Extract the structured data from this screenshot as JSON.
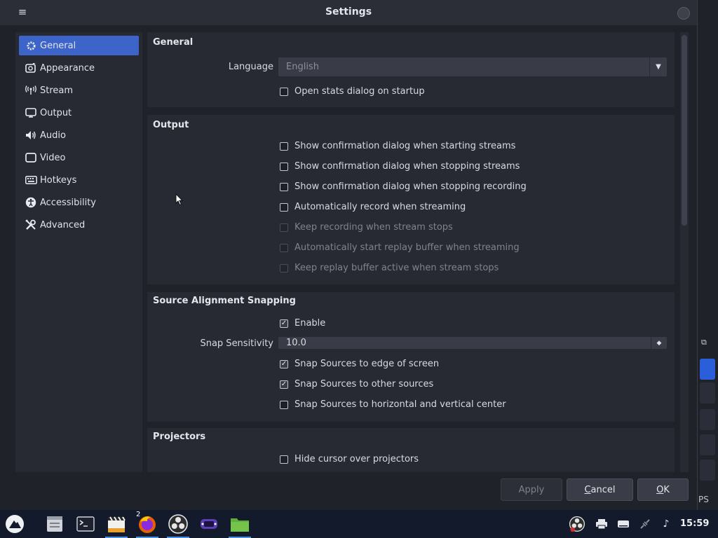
{
  "window": {
    "title": "Settings"
  },
  "sidebar": {
    "items": [
      {
        "label": "General",
        "icon": "gear-icon",
        "active": true
      },
      {
        "label": "Appearance",
        "icon": "appearance-icon"
      },
      {
        "label": "Stream",
        "icon": "broadcast-icon"
      },
      {
        "label": "Output",
        "icon": "output-icon"
      },
      {
        "label": "Audio",
        "icon": "speaker-icon"
      },
      {
        "label": "Video",
        "icon": "monitor-icon"
      },
      {
        "label": "Hotkeys",
        "icon": "keyboard-icon"
      },
      {
        "label": "Accessibility",
        "icon": "accessibility-icon"
      },
      {
        "label": "Advanced",
        "icon": "tools-icon"
      }
    ]
  },
  "general": {
    "title": "General",
    "language_label": "Language",
    "language_value": "English",
    "open_stats": "Open stats dialog on startup"
  },
  "output": {
    "title": "Output",
    "items": [
      {
        "label": "Show confirmation dialog when starting streams",
        "checked": false,
        "disabled": false
      },
      {
        "label": "Show confirmation dialog when stopping streams",
        "checked": false,
        "disabled": false
      },
      {
        "label": "Show confirmation dialog when stopping recording",
        "checked": false,
        "disabled": false
      },
      {
        "label": "Automatically record when streaming",
        "checked": false,
        "disabled": false
      },
      {
        "label": "Keep recording when stream stops",
        "checked": false,
        "disabled": true
      },
      {
        "label": "Automatically start replay buffer when streaming",
        "checked": false,
        "disabled": true
      },
      {
        "label": "Keep replay buffer active when stream stops",
        "checked": false,
        "disabled": true
      }
    ]
  },
  "snapping": {
    "title": "Source Alignment Snapping",
    "enable": "Enable",
    "sensitivity_label": "Snap Sensitivity",
    "sensitivity_value": "10.0",
    "items": [
      {
        "label": "Snap Sources to edge of screen",
        "checked": true
      },
      {
        "label": "Snap Sources to other sources",
        "checked": true
      },
      {
        "label": "Snap Sources to horizontal and vertical center",
        "checked": false
      }
    ]
  },
  "projectors": {
    "title": "Projectors",
    "hide_cursor": "Hide cursor over projectors"
  },
  "buttons": {
    "apply": "Apply",
    "cancel": "Cancel",
    "ok": "OK"
  },
  "background_app": {
    "fps_fragment": "PS"
  },
  "taskbar": {
    "firefox_badge": "2",
    "clock": "15:59"
  }
}
